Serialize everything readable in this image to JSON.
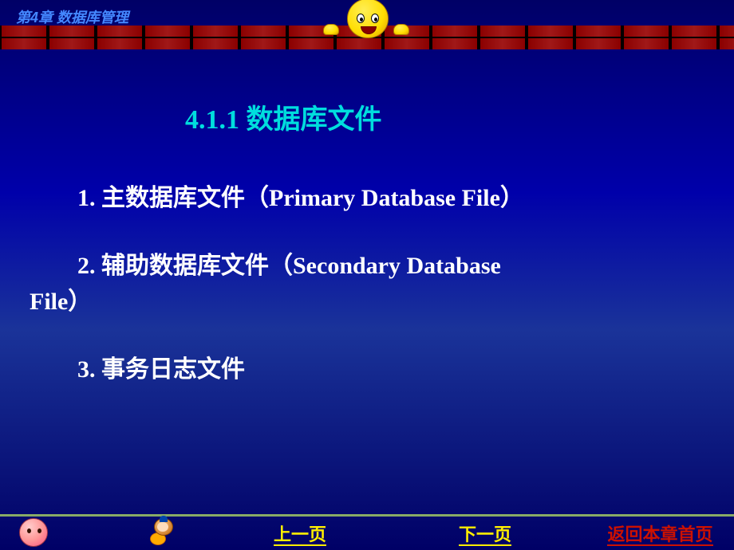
{
  "header": {
    "chapter_title": "第4章  数据库管理"
  },
  "content": {
    "section_title": "4.1.1  数据库文件",
    "item1": "1. 主数据库文件（Primary Database File）",
    "item2_line1": "2. 辅助数据库文件（Secondary Database",
    "item2_line2": "File）",
    "item3": "3. 事务日志文件"
  },
  "footer": {
    "prev_label": "上一页",
    "next_label": "下一页",
    "home_label": "返回本章首页"
  }
}
